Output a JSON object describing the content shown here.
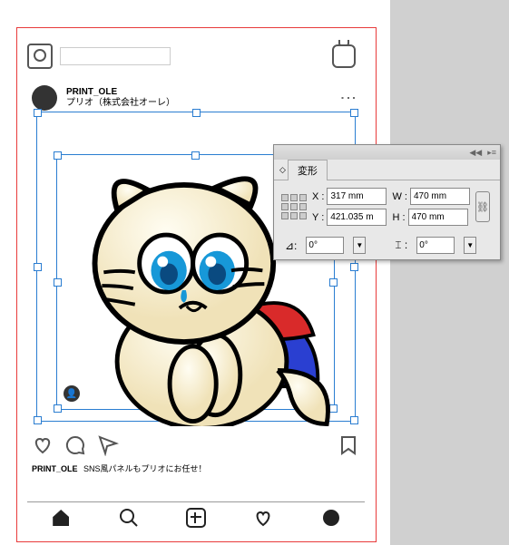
{
  "post": {
    "username": "PRINT_OLE",
    "displayname": "プリオ（株式会社オーレ）",
    "caption_user": "PRINT_OLE",
    "caption_text": "SNS風パネルもプリオにお任せ！"
  },
  "panel": {
    "title": "変形",
    "x_label": "X :",
    "x_value": "317 mm",
    "y_label": "Y :",
    "y_value": "421.035 m",
    "w_label": "W :",
    "w_value": "470 mm",
    "h_label": "H :",
    "h_value": "470 mm",
    "angle_label": "⊿:",
    "angle_value": "0°",
    "shear_label": "⌶ :",
    "shear_value": "0°",
    "flyout": "▸≡",
    "collapse": "◀◀"
  },
  "icons": {
    "tag": "👤"
  }
}
